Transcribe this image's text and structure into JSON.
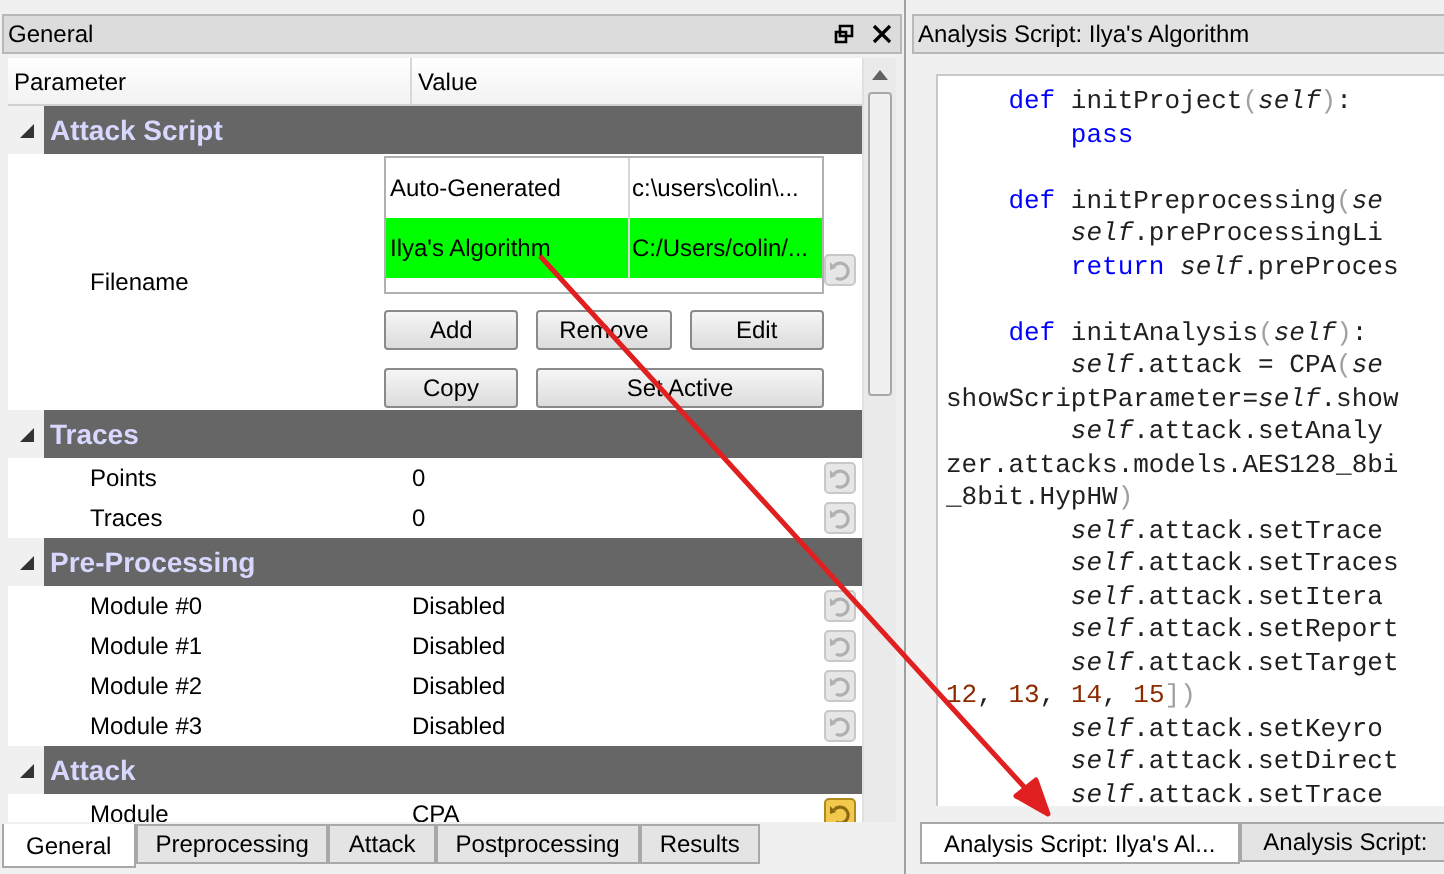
{
  "left_panel": {
    "title": "General",
    "columns": [
      "Parameter",
      "Value"
    ],
    "sections": [
      {
        "title": "Attack Script",
        "expanded": true,
        "rows": [
          {
            "kind": "list",
            "label": "Filename",
            "revert_enabled": false,
            "items": [
              {
                "name": "Auto-Generated",
                "path": "c:\\users\\colin\\...",
                "selected": false
              },
              {
                "name": "Ilya's Algorithm",
                "path": "C:/Users/colin/...",
                "selected": true
              }
            ],
            "buttons": [
              "Add",
              "Remove",
              "Edit",
              "Copy",
              "Set Active"
            ]
          }
        ]
      },
      {
        "title": "Traces",
        "expanded": true,
        "rows": [
          {
            "kind": "text",
            "label": "Points",
            "value": "0",
            "revert_enabled": false
          },
          {
            "kind": "text",
            "label": "Traces",
            "value": "0",
            "revert_enabled": false
          }
        ]
      },
      {
        "title": "Pre-Processing",
        "expanded": true,
        "rows": [
          {
            "kind": "text",
            "label": "Module #0",
            "value": "Disabled",
            "revert_enabled": false
          },
          {
            "kind": "text",
            "label": "Module #1",
            "value": "Disabled",
            "revert_enabled": false
          },
          {
            "kind": "text",
            "label": "Module #2",
            "value": "Disabled",
            "revert_enabled": false
          },
          {
            "kind": "text",
            "label": "Module #3",
            "value": "Disabled",
            "revert_enabled": false
          }
        ]
      },
      {
        "title": "Attack",
        "expanded": true,
        "rows": [
          {
            "kind": "text",
            "label": "Module",
            "value": "CPA",
            "revert_enabled": true
          }
        ]
      }
    ],
    "tabs": [
      {
        "label": "General",
        "selected": true
      },
      {
        "label": "Preprocessing",
        "selected": false
      },
      {
        "label": "Attack",
        "selected": false
      },
      {
        "label": "Postprocessing",
        "selected": false
      },
      {
        "label": "Results",
        "selected": false
      }
    ]
  },
  "right_panel": {
    "title": "Analysis Script: Ilya's Algorithm",
    "code_lines": [
      {
        "kind": "code",
        "segments": [
          {
            "text": "    def",
            "kind": "keyword"
          },
          {
            "text": " initProject"
          },
          {
            "text": "(",
            "kind": "punct"
          },
          {
            "text": "self",
            "kind": "self"
          },
          {
            "text": ")",
            "kind": "punct"
          },
          {
            "text": ":"
          }
        ]
      },
      {
        "kind": "code",
        "segments": [
          {
            "text": "        pass",
            "kind": "keyword"
          }
        ]
      },
      {
        "kind": "blank"
      },
      {
        "kind": "code",
        "segments": [
          {
            "text": "    def",
            "kind": "keyword"
          },
          {
            "text": " initPreprocessing"
          },
          {
            "text": "(",
            "kind": "punct"
          },
          {
            "text": "se",
            "kind": "self"
          }
        ]
      },
      {
        "kind": "code",
        "segments": [
          {
            "text": "        self",
            "kind": "self"
          },
          {
            "text": ".preProcessingLi"
          }
        ]
      },
      {
        "kind": "code",
        "segments": [
          {
            "text": "        return ",
            "kind": "keyword"
          },
          {
            "text": "self",
            "kind": "self"
          },
          {
            "text": ".preProces"
          }
        ]
      },
      {
        "kind": "blank"
      },
      {
        "kind": "code",
        "segments": [
          {
            "text": "    def",
            "kind": "keyword"
          },
          {
            "text": " initAnalysis"
          },
          {
            "text": "(",
            "kind": "punct"
          },
          {
            "text": "self",
            "kind": "self"
          },
          {
            "text": ")",
            "kind": "punct"
          },
          {
            "text": ":"
          }
        ]
      },
      {
        "kind": "code",
        "segments": [
          {
            "text": "        self",
            "kind": "self"
          },
          {
            "text": ".attack = CPA"
          },
          {
            "text": "(",
            "kind": "punct"
          },
          {
            "text": "se",
            "kind": "self"
          }
        ]
      },
      {
        "kind": "code",
        "segments": [
          {
            "text": "showScriptParameter="
          },
          {
            "text": "self",
            "kind": "self"
          },
          {
            "text": ".show"
          }
        ]
      },
      {
        "kind": "code",
        "segments": [
          {
            "text": "        self",
            "kind": "self"
          },
          {
            "text": ".attack.setAnaly"
          }
        ]
      },
      {
        "kind": "code",
        "segments": [
          {
            "text": "zer.attacks.models.AES128_8bi"
          }
        ]
      },
      {
        "kind": "code",
        "segments": [
          {
            "text": "_8bit.HypHW"
          },
          {
            "text": ")",
            "kind": "punct"
          }
        ]
      },
      {
        "kind": "code",
        "segments": [
          {
            "text": "        self",
            "kind": "self"
          },
          {
            "text": ".attack.setTrace"
          }
        ]
      },
      {
        "kind": "code",
        "segments": [
          {
            "text": "        self",
            "kind": "self"
          },
          {
            "text": ".attack.setTraces"
          }
        ]
      },
      {
        "kind": "code",
        "segments": [
          {
            "text": "        self",
            "kind": "self"
          },
          {
            "text": ".attack.setItera"
          }
        ]
      },
      {
        "kind": "code",
        "segments": [
          {
            "text": "        self",
            "kind": "self"
          },
          {
            "text": ".attack.setReport"
          }
        ]
      },
      {
        "kind": "code",
        "segments": [
          {
            "text": "        self",
            "kind": "self"
          },
          {
            "text": ".attack.setTarget"
          }
        ]
      },
      {
        "kind": "code",
        "segments": [
          {
            "text": "12",
            "kind": "number"
          },
          {
            "text": ", "
          },
          {
            "text": "13",
            "kind": "number"
          },
          {
            "text": ", "
          },
          {
            "text": "14",
            "kind": "number"
          },
          {
            "text": ", "
          },
          {
            "text": "15",
            "kind": "number"
          },
          {
            "text": "])",
            "kind": "punct"
          }
        ]
      },
      {
        "kind": "code",
        "segments": [
          {
            "text": "        self",
            "kind": "self"
          },
          {
            "text": ".attack.setKeyro"
          }
        ]
      },
      {
        "kind": "code",
        "segments": [
          {
            "text": "        self",
            "kind": "self"
          },
          {
            "text": ".attack.setDirect"
          }
        ]
      },
      {
        "kind": "code",
        "segments": [
          {
            "text": "        self",
            "kind": "self"
          },
          {
            "text": ".attack.setTrace"
          }
        ]
      }
    ],
    "tabs": [
      {
        "label": "Analysis Script: Ilya's Al...",
        "selected": true
      },
      {
        "label": "Analysis Script:",
        "selected": false
      }
    ]
  }
}
